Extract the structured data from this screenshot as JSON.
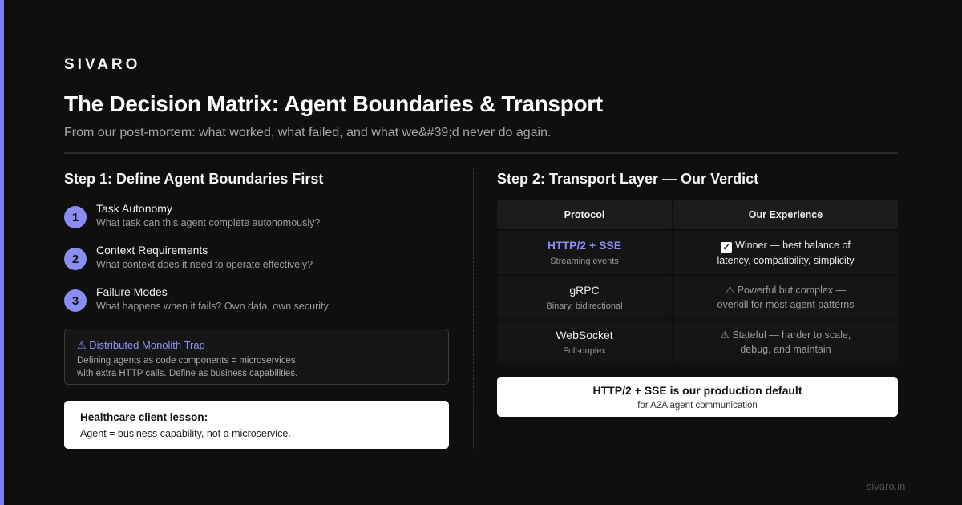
{
  "brand": "SIVARO",
  "title": "The Decision Matrix: Agent Boundaries & Transport",
  "subtitle": "From our post-mortem: what worked, what failed, and what we&#39;d never do again.",
  "step1": {
    "heading": "Step 1: Define Agent Boundaries First",
    "criteria": [
      {
        "num": "1",
        "title": "Task Autonomy",
        "desc": "What task can this agent complete autonomously?"
      },
      {
        "num": "2",
        "title": "Context Requirements",
        "desc": "What context does it need to operate effectively?"
      },
      {
        "num": "3",
        "title": "Failure Modes",
        "desc": "What happens when it fails? Own data, own security."
      }
    ],
    "trap": {
      "title": "⚠ Distributed Monolith Trap",
      "line1": "Defining agents as code components = microservices",
      "line2": "with extra HTTP calls. Define as business capabilities."
    },
    "lesson": {
      "title": "Healthcare client lesson:",
      "body": "Agent = business capability, not a microservice."
    }
  },
  "step2": {
    "heading": "Step 2: Transport Layer — Our Verdict",
    "columns": [
      "Protocol",
      "Our Experience"
    ],
    "rows": [
      {
        "protocol": "HTTP/2 + SSE",
        "desc": "Streaming events",
        "verdict1": "Winner — best balance of",
        "verdict2": "latency, compatibility, simplicity"
      },
      {
        "protocol": "gRPC",
        "desc": "Binary, bidirectional",
        "verdict1": "⚠ Powerful but complex —",
        "verdict2": "overkill for most agent patterns"
      },
      {
        "protocol": "WebSocket",
        "desc": "Full-duplex",
        "verdict1": "⚠ Stateful — harder to scale,",
        "verdict2": "debug, and maintain"
      }
    ],
    "default": {
      "title": "HTTP/2 + SSE is our production default",
      "sub": "for A2A agent communication"
    }
  },
  "footer": "sivaro.in",
  "colors": {
    "accent": "#7b7ff0",
    "highlight": "#8a8ef2",
    "background": "#0f0f0f"
  }
}
